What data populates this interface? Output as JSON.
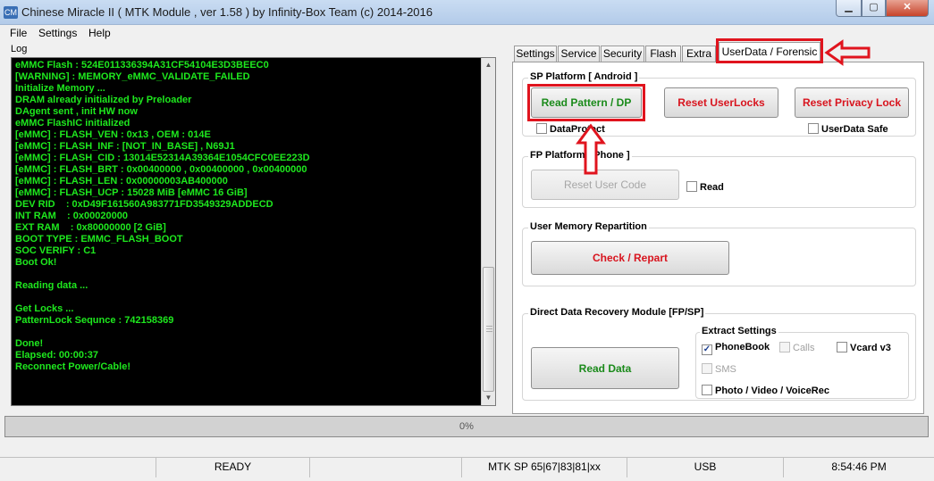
{
  "window": {
    "title": "Chinese Miracle II ( MTK Module , ver 1.58 ) by Infinity-Box Team (c) 2014-2016",
    "app_icon": "CM",
    "minimize": "▁",
    "maximize": "▢",
    "close": "✕"
  },
  "menu": [
    "File",
    "Settings",
    "Help"
  ],
  "log": {
    "label": "Log",
    "lines": [
      "eMMC Flash : 524E011336394A31CF54104E3D3BEEC0",
      "[WARNING] : MEMORY_eMMC_VALIDATE_FAILED",
      "Initialize Memory ...",
      "DRAM already initialized by Preloader",
      "DAgent sent , init HW now",
      "eMMC FlashIC initialized",
      "[eMMC] : FLASH_VEN : 0x13 , OEM : 014E",
      "[eMMC] : FLASH_INF : [NOT_IN_BASE] , N69J1",
      "[eMMC] : FLASH_CID : 13014E52314A39364E1054CFC0EE223D",
      "[eMMC] : FLASH_BRT : 0x00400000 , 0x00400000 , 0x00400000",
      "[eMMC] : FLASH_LEN : 0x00000003AB400000",
      "[eMMC] : FLASH_UCP : 15028 MiB [eMMC 16 GiB]",
      "DEV RID    : 0xD49F161560A983771FD3549329ADDECD",
      "INT RAM    : 0x00020000",
      "EXT RAM    : 0x80000000 [2 GiB]",
      "BOOT TYPE : EMMC_FLASH_BOOT",
      "SOC VERIFY : C1",
      "Boot Ok!",
      "",
      "Reading data ...",
      "",
      "Get Locks ...",
      "PatternLock Sequnce : 742158369",
      "",
      "Done!",
      "Elapsed: 00:00:37",
      "Reconnect Power/Cable!"
    ]
  },
  "tabs": [
    "Settings",
    "Service",
    "Security",
    "Flash",
    "Extra",
    "UserData / Forensic"
  ],
  "sp_platform": {
    "title": "SP Platform [ Android ]",
    "read_pattern": "Read Pattern / DP",
    "reset_userlocks": "Reset UserLocks",
    "reset_privacy": "Reset Privacy Lock",
    "dataprotect": "DataProtect",
    "userdata_safe": "UserData Safe"
  },
  "fp_platform": {
    "title": "FP Platform [ Phone ]",
    "reset_user_code": "Reset User Code",
    "read": "Read"
  },
  "user_memory": {
    "title": "User Memory Repartition",
    "check_repart": "Check / Repart"
  },
  "ddr": {
    "title": "Direct Data Recovery Module  [FP/SP]",
    "read_data": "Read Data",
    "extract_title": "Extract Settings",
    "phonebook": "PhoneBook",
    "calls": "Calls",
    "vcard": "Vcard v3",
    "sms": "SMS",
    "photo": "Photo / Video / VoiceRec",
    "check_mark": "✓"
  },
  "progress": "0%",
  "status": {
    "ready": "READY",
    "mtk": "MTK SP 65|67|83|81|xx",
    "usb": "USB",
    "time": "8:54:46 PM"
  },
  "annotation_color": "#e0141e",
  "accent_green": "#1a8a1a",
  "accent_red": "#d8141e",
  "log_text_color": "#1ee81e"
}
